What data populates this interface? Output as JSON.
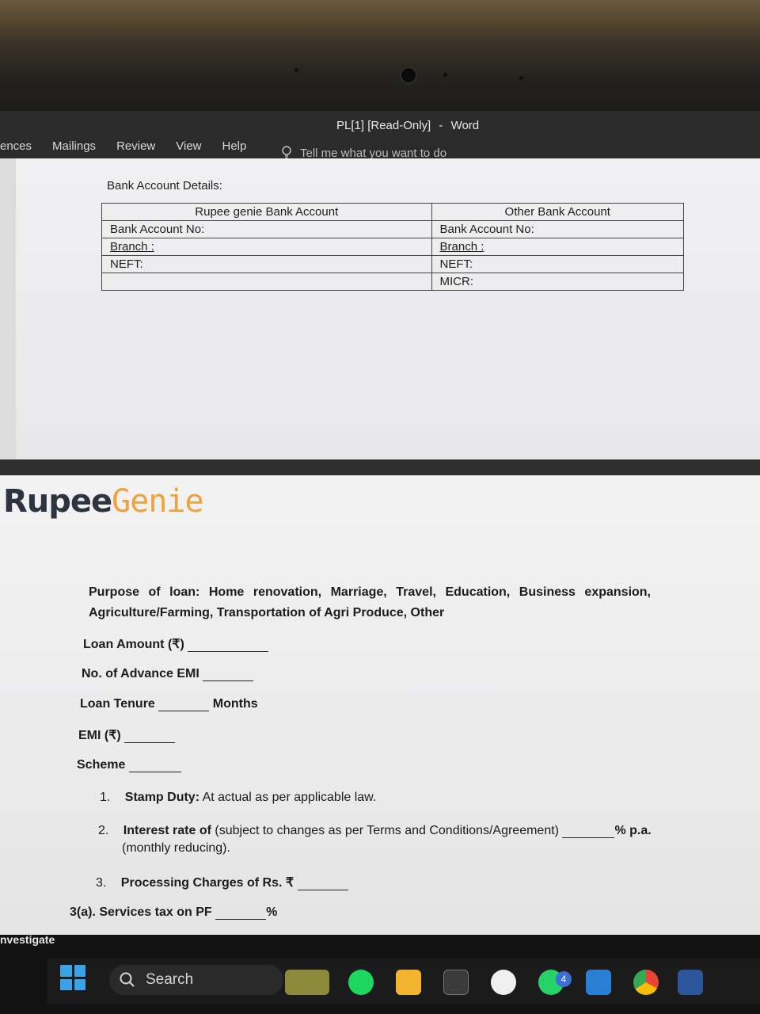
{
  "window": {
    "doc_title": "PL[1] [Read-Only]",
    "separator": "-",
    "app_name": "Word"
  },
  "ribbon": {
    "tabs": [
      "ences",
      "Mailings",
      "Review",
      "View",
      "Help"
    ],
    "tell_me": "Tell me what you want to do"
  },
  "page1": {
    "bank_label": "Bank Account Details:",
    "left_header": "Rupee genie Bank Account",
    "right_header": "Other Bank Account",
    "left_rows": [
      "Bank Account No:",
      "Branch :",
      "NEFT:",
      ""
    ],
    "right_rows": [
      "Bank Account No:",
      "Branch :",
      "NEFT:",
      "MICR:"
    ]
  },
  "page2": {
    "logo_part1": "Rupee",
    "logo_part2": "Genie",
    "purpose": "Purpose of loan: Home renovation, Marriage, Travel, Education, Business expansion, Agriculture/Farming, Transportation of Agri Produce, Other",
    "loan_amount": "Loan Amount (₹)",
    "advance_emi": "No. of Advance EMI",
    "loan_tenure": "Loan Tenure",
    "months": "Months",
    "emi": "EMI (₹)",
    "scheme": "Scheme",
    "item1_num": "1.",
    "item1_bold": "Stamp Duty:",
    "item1_text": "At actual as per applicable law.",
    "item2_num": "2.",
    "item2_bold": "Interest rate of",
    "item2_text": "(subject to changes as per Terms and Conditions/Agreement)",
    "item2_suffix": "% p.a.",
    "item2_line2": "(monthly reducing).",
    "item3_num": "3.",
    "item3_bold": "Processing Charges of Rs. ₹",
    "item3a": "3(a). Services tax on PF",
    "item3a_suffix": "%"
  },
  "taskbar": {
    "left_label": "nvestigate",
    "search": "Search",
    "whatsapp_badge": "4"
  }
}
